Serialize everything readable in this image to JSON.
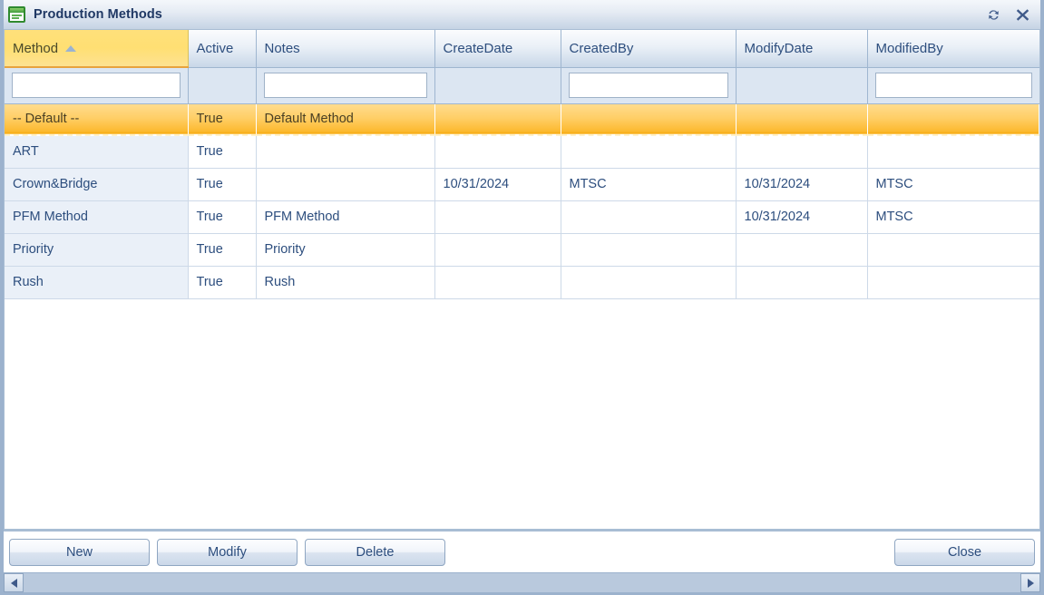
{
  "window": {
    "title": "Production Methods",
    "icon": "form-document-icon",
    "accent_orange": "#f6a90f",
    "accent_yellow": "#ffdf73",
    "accent_blue": "#2d4e7e",
    "actions": [
      {
        "name": "refresh-button",
        "glyph": "refresh-icon"
      },
      {
        "name": "close-window-button",
        "glyph": "close-icon"
      }
    ]
  },
  "grid": {
    "columns": [
      {
        "key": "method",
        "label": "Method",
        "sorted": true,
        "sort_direction": "asc",
        "has_filter": true,
        "filter_value": ""
      },
      {
        "key": "active",
        "label": "Active",
        "sorted": false,
        "has_filter": false,
        "filter_value": ""
      },
      {
        "key": "notes",
        "label": "Notes",
        "sorted": false,
        "has_filter": true,
        "filter_value": ""
      },
      {
        "key": "createdate",
        "label": "CreateDate",
        "sorted": false,
        "has_filter": false,
        "filter_value": ""
      },
      {
        "key": "createdby",
        "label": "CreatedBy",
        "sorted": false,
        "has_filter": true,
        "filter_value": ""
      },
      {
        "key": "modifydate",
        "label": "ModifyDate",
        "sorted": false,
        "has_filter": false,
        "filter_value": ""
      },
      {
        "key": "modifiedby",
        "label": "ModifiedBy",
        "sorted": false,
        "has_filter": true,
        "filter_value": ""
      }
    ],
    "rows": [
      {
        "selected": true,
        "method": "-- Default --",
        "active": "True",
        "notes": "Default Method",
        "createdate": "",
        "createdby": "",
        "modifydate": "",
        "modifiedby": ""
      },
      {
        "selected": false,
        "method": "ART",
        "active": "True",
        "notes": "",
        "createdate": "",
        "createdby": "",
        "modifydate": "",
        "modifiedby": ""
      },
      {
        "selected": false,
        "method": "Crown&Bridge",
        "active": "True",
        "notes": "",
        "createdate": "10/31/2024",
        "createdby": "MTSC",
        "modifydate": "10/31/2024",
        "modifiedby": "MTSC"
      },
      {
        "selected": false,
        "method": "PFM Method",
        "active": "True",
        "notes": "PFM Method",
        "createdate": "",
        "createdby": "",
        "modifydate": "10/31/2024",
        "modifiedby": "MTSC"
      },
      {
        "selected": false,
        "method": "Priority",
        "active": "True",
        "notes": "Priority",
        "createdate": "",
        "createdby": "",
        "modifydate": "",
        "modifiedby": ""
      },
      {
        "selected": false,
        "method": "Rush",
        "active": "True",
        "notes": "Rush",
        "createdate": "",
        "createdby": "",
        "modifydate": "",
        "modifiedby": ""
      }
    ]
  },
  "buttons": {
    "new": "New",
    "modify": "Modify",
    "delete": "Delete",
    "close": "Close"
  },
  "scrollbar": {
    "left_arrow": "scroll-left-icon",
    "right_arrow": "scroll-right-icon"
  }
}
